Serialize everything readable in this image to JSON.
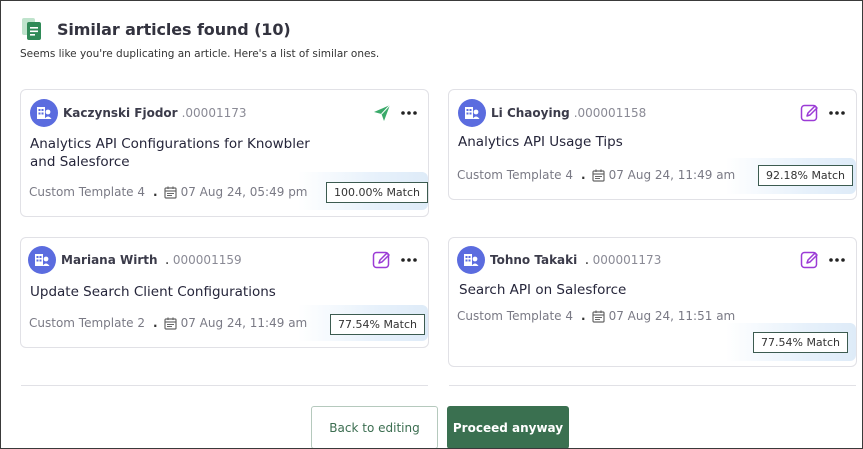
{
  "header": {
    "title": "Similar articles found (10)",
    "subtitle": "Seems like you're duplicating an article. Here's a list of similar ones."
  },
  "articles": [
    {
      "author": "Kaczynski Fjodor",
      "id": ".00001173",
      "title": "Analytics API Configurations for Knowbler and Salesforce",
      "template": "Custom Template 4",
      "date": "07 Aug 24, 05:49 pm",
      "match": "100.00% Match",
      "action_icon": "send-icon"
    },
    {
      "author": "Li Chaoying",
      "id": ".000001158",
      "title": "Analytics API Usage Tips",
      "template": "Custom Template 4",
      "date": "07 Aug 24, 11:49 am",
      "match": "92.18% Match",
      "action_icon": "edit-icon"
    },
    {
      "author": "Mariana Wirth",
      "id": "000001159",
      "title": "Update Search Client Configurations",
      "template": "Custom Template 2",
      "date": "07 Aug 24, 11:49 am",
      "match": "77.54% Match",
      "action_icon": "edit-icon"
    },
    {
      "author": "Tohno Takaki",
      "id": "000001173",
      "title": "Search API on Salesforce",
      "template": "Custom Template 4",
      "date": "07 Aug 24, 11:51 am",
      "match": "77.54% Match",
      "action_icon": "edit-icon"
    }
  ],
  "buttons": {
    "back": "Back to editing",
    "proceed": "Proceed anyway"
  },
  "colors": {
    "accent": "#3a7050",
    "avatar": "#5b6cdf",
    "send": "#3aaa6a",
    "edit": "#9b3bd6"
  }
}
